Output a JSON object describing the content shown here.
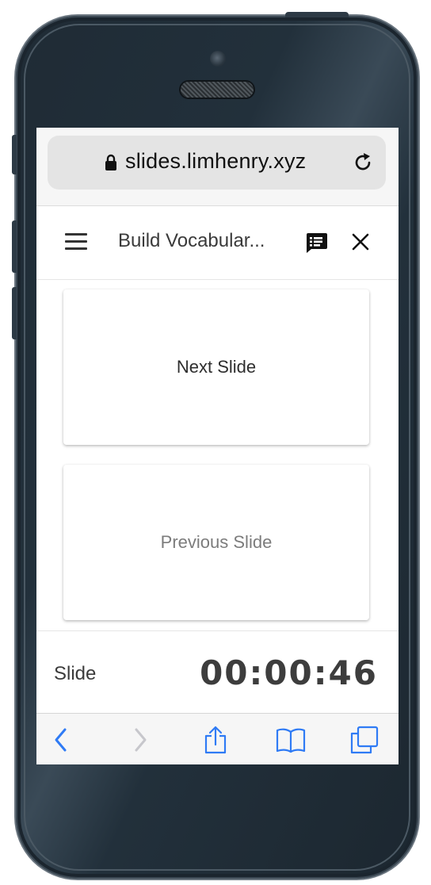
{
  "browser": {
    "url": "slides.limhenry.xyz",
    "icons": {
      "lock": "lock-icon",
      "reload": "reload-icon",
      "back": "back-icon",
      "forward": "forward-icon",
      "share": "share-icon",
      "bookmarks": "bookmarks-icon",
      "tabs": "tabs-icon"
    }
  },
  "appbar": {
    "title": "Build Vocabular...",
    "icons": {
      "menu": "menu-icon",
      "notes": "speaker-notes-icon",
      "close": "close-icon"
    }
  },
  "cards": {
    "next_label": "Next Slide",
    "previous_label": "Previous Slide"
  },
  "footer": {
    "slide_label": "Slide",
    "timer": "00:00:46"
  },
  "colors": {
    "ios_blue": "#2f7bf5",
    "disabled": "#c7c7cc",
    "phone_body": "#1f2b35"
  }
}
